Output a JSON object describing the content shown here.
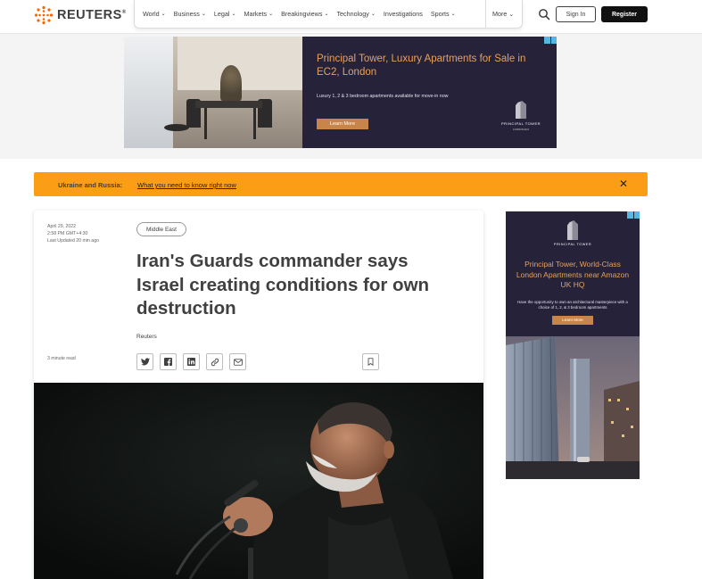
{
  "brand": {
    "name": "REUTERS",
    "reg": "®"
  },
  "nav": {
    "items": [
      {
        "label": "World",
        "chevron": true
      },
      {
        "label": "Business",
        "chevron": true
      },
      {
        "label": "Legal",
        "chevron": true
      },
      {
        "label": "Markets",
        "chevron": true
      },
      {
        "label": "Breakingviews",
        "chevron": true
      },
      {
        "label": "Technology",
        "chevron": true
      },
      {
        "label": "Investigations",
        "chevron": false
      },
      {
        "label": "Sports",
        "chevron": true
      }
    ],
    "more_label": "More",
    "sign_in": "Sign In",
    "register": "Register"
  },
  "top_ad": {
    "headline": "Principal Tower, Luxury Apartments for Sale in EC2, London",
    "sub": "Luxury 1, 2 & 3 bedroom apartments available for move-in now",
    "cta": "Learn More",
    "brand": "PRINCIPAL TOWER",
    "brand_sub": "LONDON EC2"
  },
  "banner": {
    "topic": "Ukraine and Russia:",
    "link": "What you need to know right now",
    "close_glyph": "✕"
  },
  "article": {
    "date": "April 29, 2022",
    "time": "2:58 PM GMT+4:30",
    "updated": "Last Updated 20 min ago",
    "tag": "Middle East",
    "title": "Iran's Guards commander says Israel creating conditions for own destruction",
    "byline": "Reuters",
    "read_time": "3 minute read"
  },
  "side_ad": {
    "brand": "PRINCIPAL TOWER",
    "headline": "Principal Tower, World-Class London Apartments near Amazon UK HQ",
    "sub": "Have the opportunity to own an architectural masterpiece with a choice of 1, 2, & 3 bedroom apartments",
    "cta": "Learn More"
  },
  "colors": {
    "banner": "#fb9e15",
    "ad_bg": "#25223a",
    "ad_accent": "#e8a15b",
    "register_bg": "#111111"
  }
}
